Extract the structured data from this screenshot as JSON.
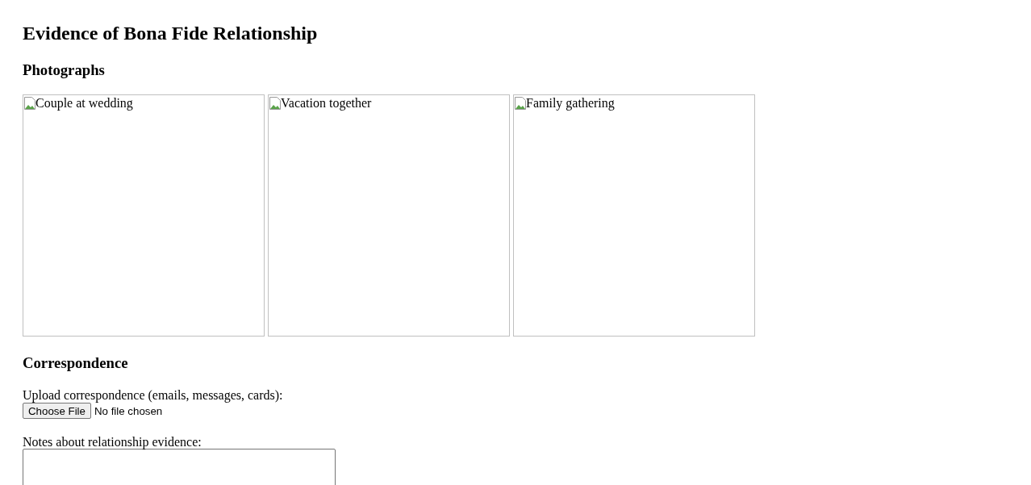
{
  "title": "Evidence of Bona Fide Relationship",
  "photographs": {
    "heading": "Photographs",
    "images": [
      {
        "kind": "picture",
        "alt": "Couple at wedding"
      },
      {
        "kind": "picture",
        "alt": "Vacation together"
      },
      {
        "kind": "picture",
        "alt": "Family gathering"
      }
    ]
  },
  "correspondence": {
    "heading": "Correspondence",
    "upload_label": "Upload correspondence (emails, messages, cards):",
    "button": "Choose File",
    "file_status": "No file chosen",
    "notes_label": "Notes about relationship evidence:"
  }
}
